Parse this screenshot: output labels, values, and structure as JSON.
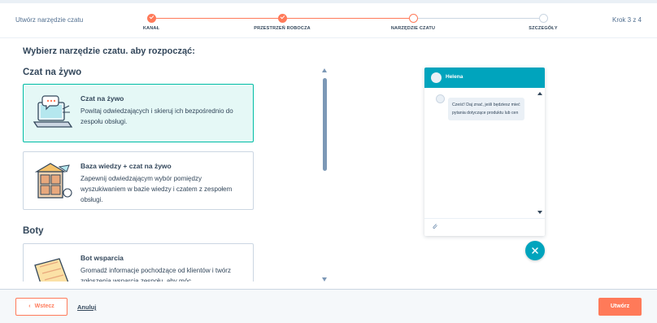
{
  "header": {
    "title": "Utwórz narzędzie czatu",
    "step_counter": "Krok 3 z 4",
    "steps": [
      {
        "label": "KANAŁ",
        "state": "done"
      },
      {
        "label": "PRZESTRZEŃ ROBOCZA",
        "state": "done"
      },
      {
        "label": "NARZĘDZIE CZATU",
        "state": "current"
      },
      {
        "label": "SZCZEGÓŁY",
        "state": "todo"
      }
    ]
  },
  "main": {
    "heading": "Wybierz narzędzie czatu. aby rozpocząć:",
    "sections": [
      {
        "title": "Czat na żywo",
        "cards": [
          {
            "title": "Czat na żywo",
            "description": "Powitaj odwiedzających i skieruj ich bezpośrednio do zespołu obsługi.",
            "selected": true,
            "icon": "laptop-chat-icon"
          },
          {
            "title": "Baza wiedzy + czat na żywo",
            "description": "Zapewnij odwiedzającym wybór pomiędzy wyszukiwaniem w bazie wiedzy i czatem z zespołem obsługi.",
            "selected": false,
            "icon": "knowledge-base-icon"
          }
        ]
      },
      {
        "title": "Boty",
        "cards": [
          {
            "title": "Bot wsparcia",
            "description": "Gromadź informacje pochodzące od klientów i twórz zgłoszenia wsparcia zespołu, aby móc",
            "selected": false,
            "icon": "ticket-icon"
          }
        ]
      }
    ]
  },
  "preview": {
    "agent_name": "Helena",
    "message": "Cześć! Daj znać, jeśli będziesz mieć pytania dotyczące produktu lub cen"
  },
  "footer": {
    "back_label": "Wstecz",
    "cancel_label": "Anuluj",
    "create_label": "Utwórz"
  },
  "colors": {
    "accent": "#ff7a59",
    "teal": "#00a4bd",
    "selected_border": "#00bda5",
    "text": "#33475b"
  }
}
